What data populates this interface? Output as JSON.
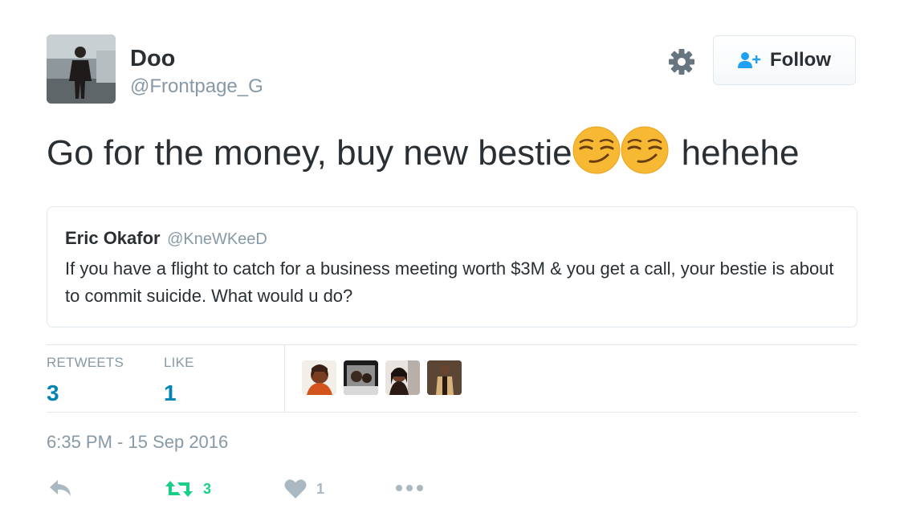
{
  "author": {
    "display_name": "Doo",
    "handle": "@Frontpage_G"
  },
  "follow_button": {
    "label": "Follow"
  },
  "tweet": {
    "text_before": "Go for the money, buy new bestie",
    "text_after": "hehehe",
    "emojis": [
      "smirking-face",
      "smirking-face"
    ]
  },
  "quoted_tweet": {
    "display_name": "Eric Okafor",
    "handle": "@KneWKeeD",
    "text": "If you have a flight to catch for a business meeting worth $3M &  you get a call, your bestie is about to commit suicide.  What would u do?"
  },
  "stats": {
    "retweets_label": "RETWEETS",
    "retweets_count": "3",
    "likes_label": "LIKE",
    "likes_count": "1"
  },
  "timestamp": "6:35 PM - 15 Sep 2016",
  "actions": {
    "retweet_count": "3",
    "like_count": "1"
  },
  "colors": {
    "link_blue": "#0084b4",
    "muted_gray": "#8899a6",
    "retweet_green": "#19cf86",
    "border": "#e1e8ed"
  }
}
